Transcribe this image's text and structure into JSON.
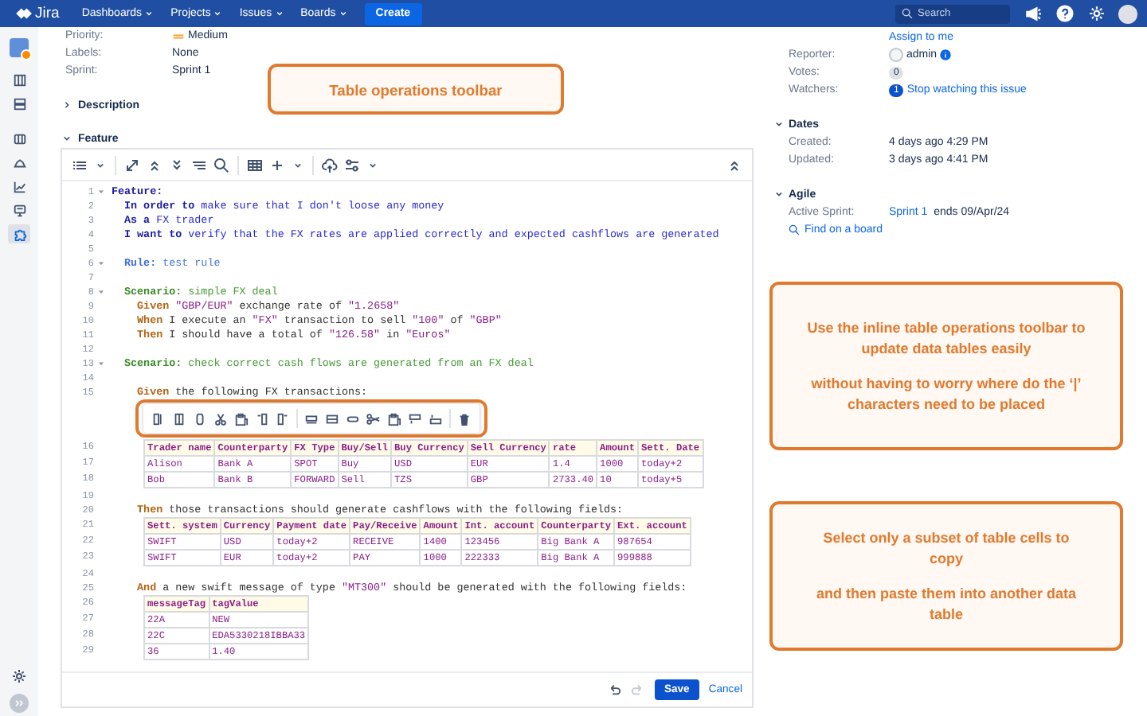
{
  "topbar": {
    "menus": [
      {
        "label": "Dashboards"
      },
      {
        "label": "Projects"
      },
      {
        "label": "Issues"
      },
      {
        "label": "Boards"
      }
    ],
    "logo": "Jira",
    "create": "Create",
    "search": {
      "placeholder": "Search"
    }
  },
  "sidebar": {
    "items": [
      {
        "selected": false
      },
      {
        "selected": false
      },
      {
        "selected": false
      },
      {
        "selected": false
      },
      {
        "selected": false
      },
      {
        "selected": false
      },
      {
        "selected": true
      }
    ]
  },
  "fields": [
    {
      "label": "Priority:",
      "value": "Medium",
      "kind": "priority"
    },
    {
      "label": "Labels:",
      "value": "None",
      "kind": "text"
    },
    {
      "label": "Sprint:",
      "value": "Sprint 1",
      "kind": "text"
    }
  ],
  "sections": [
    {
      "title": "Description",
      "expanded": false
    },
    {
      "title": "Feature",
      "expanded": true
    }
  ],
  "editor": {
    "lines": [
      {
        "kind": "feature",
        "number": "1",
        "foldable": true,
        "tokens": [
          {
            "kind": "keyword",
            "text": "Feature:"
          }
        ]
      },
      {
        "kind": "narrative",
        "number": "2",
        "foldable": false,
        "tokens": [
          {
            "kind": "keyword",
            "text": "In order to"
          },
          {
            "kind": "narrative",
            "text": " make sure that I don't loose any money"
          }
        ]
      },
      {
        "kind": "narrative",
        "number": "3",
        "foldable": false,
        "tokens": [
          {
            "kind": "keyword",
            "text": "As a"
          },
          {
            "kind": "narrative",
            "text": " FX trader"
          }
        ]
      },
      {
        "kind": "narrative",
        "number": "4",
        "foldable": false,
        "tokens": [
          {
            "kind": "keyword",
            "text": "I want to"
          },
          {
            "kind": "narrative",
            "text": " verify that the FX rates are applied correctly and expected cashflows are generated"
          }
        ]
      },
      {
        "kind": "blank",
        "number": "5",
        "foldable": false
      },
      {
        "kind": "rule",
        "number": "6",
        "foldable": true,
        "tokens": [
          {
            "kind": "rule_keyword",
            "text": "Rule:"
          },
          {
            "kind": "rule",
            "text": " test rule"
          }
        ]
      },
      {
        "kind": "blank",
        "number": "7",
        "foldable": false
      },
      {
        "kind": "scenario",
        "number": "8",
        "foldable": true,
        "tokens": [
          {
            "kind": "scenario_keyword",
            "text": "Scenario:"
          },
          {
            "kind": "scenario",
            "text": " simple FX deal"
          }
        ]
      },
      {
        "kind": "step",
        "number": "9",
        "foldable": false,
        "tokens": [
          {
            "kind": "step_keyword",
            "text": "Given"
          },
          {
            "kind": "string",
            "text": " \"GBP/EUR\""
          },
          {
            "kind": "text",
            "text": " exchange rate of "
          },
          {
            "kind": "string",
            "text": "\"1.2658\""
          }
        ]
      },
      {
        "kind": "step",
        "number": "10",
        "foldable": false,
        "tokens": [
          {
            "kind": "step_keyword",
            "text": "When"
          },
          {
            "kind": "text",
            "text": " I execute an "
          },
          {
            "kind": "string",
            "text": "\"FX\""
          },
          {
            "kind": "text",
            "text": " transaction to sell "
          },
          {
            "kind": "string",
            "text": "\"100\""
          },
          {
            "kind": "text",
            "text": " of "
          },
          {
            "kind": "string",
            "text": "\"GBP\""
          }
        ]
      },
      {
        "kind": "step",
        "number": "11",
        "foldable": false,
        "tokens": [
          {
            "kind": "step_keyword",
            "text": "Then"
          },
          {
            "kind": "text",
            "text": " I should have a total of "
          },
          {
            "kind": "string",
            "text": "\"126.58\""
          },
          {
            "kind": "text",
            "text": " in "
          },
          {
            "kind": "string",
            "text": "\"Euros\""
          }
        ]
      },
      {
        "kind": "blank",
        "number": "12",
        "foldable": false
      },
      {
        "kind": "scenario",
        "number": "13",
        "foldable": true,
        "tokens": [
          {
            "kind": "scenario_keyword",
            "text": "Scenario:"
          },
          {
            "kind": "scenario",
            "text": " check correct cash flows are generated from an FX deal"
          }
        ]
      },
      {
        "kind": "blank",
        "number": "14",
        "foldable": false
      },
      {
        "kind": "step",
        "number": "15",
        "foldable": false,
        "tokens": [
          {
            "kind": "step_keyword",
            "text": "Given"
          },
          {
            "kind": "text",
            "text": " the following FX transactions:"
          }
        ]
      },
      {
        "kind": "table",
        "toolbar": {
          "highlighted": true
        },
        "rows": [
          {
            "number": "16",
            "cells": [
              "Trader name",
              "Counterparty",
              "FX Type",
              "Buy/Sell",
              "Buy Currency",
              "Sell Currency",
              "rate",
              "Amount",
              "Sett. Date"
            ]
          },
          {
            "number": "17",
            "cells": [
              "Alison",
              "Bank A",
              "SPOT",
              "Buy",
              "USD",
              "EUR",
              "1.4",
              "1000",
              "today+2"
            ]
          },
          {
            "number": "18",
            "cells": [
              "Bob",
              "Bank B",
              "FORWARD",
              "Sell",
              "TZS",
              "GBP",
              "2733.40",
              "10",
              "today+5"
            ]
          }
        ]
      },
      {
        "kind": "blank",
        "number": "19",
        "foldable": false
      },
      {
        "kind": "step",
        "number": "20",
        "foldable": false,
        "tokens": [
          {
            "kind": "step_keyword",
            "text": "Then"
          },
          {
            "kind": "text",
            "text": " those transactions should generate cashflows with the following fields:"
          }
        ]
      },
      {
        "kind": "table",
        "rows": [
          {
            "number": "21",
            "cells": [
              "Sett. system",
              "Currency",
              "Payment date",
              "Pay/Receive",
              "Amount",
              "Int. account",
              "Counterparty",
              "Ext. account"
            ]
          },
          {
            "number": "22",
            "cells": [
              "SWIFT",
              "USD",
              "today+2",
              "RECEIVE",
              "1400",
              "123456",
              "Big Bank A",
              "987654"
            ]
          },
          {
            "number": "23",
            "cells": [
              "SWIFT",
              "EUR",
              "today+2",
              "PAY",
              "1000",
              "222333",
              "Big Bank A",
              "999888"
            ]
          }
        ]
      },
      {
        "kind": "blank",
        "number": "24",
        "foldable": false
      },
      {
        "kind": "step",
        "number": "25",
        "foldable": false,
        "tokens": [
          {
            "kind": "step_keyword",
            "text": "And"
          },
          {
            "kind": "text",
            "text": " a new swift message of type "
          },
          {
            "kind": "string",
            "text": "\"MT300\""
          },
          {
            "kind": "text",
            "text": " should be generated with the following fields:"
          }
        ]
      },
      {
        "kind": "table",
        "rows": [
          {
            "number": "26",
            "cells": [
              "messageTag",
              "tagValue"
            ]
          },
          {
            "number": "27",
            "cells": [
              "22A",
              "NEW"
            ]
          },
          {
            "number": "28",
            "cells": [
              "22C",
              "EDA5330218IBBA33"
            ]
          },
          {
            "number": "29",
            "cells": [
              "36",
              "1.40"
            ]
          }
        ]
      }
    ],
    "save": "Save",
    "cancel": "Cancel"
  },
  "people": {
    "assign_link": "Assign to me",
    "rows": [
      {
        "kind": "user",
        "label": "Reporter:",
        "value": "admin"
      },
      {
        "kind": "count",
        "label": "Votes:",
        "count": "0"
      },
      {
        "kind": "watch",
        "label": "Watchers:",
        "count": "1",
        "link": "Stop watching this issue"
      }
    ]
  },
  "dates": {
    "title": "Dates",
    "expanded": true,
    "rows": [
      {
        "label": "Created:",
        "value": "4 days ago 4:29 PM"
      },
      {
        "label": "Updated:",
        "value": "3 days ago 4:41 PM"
      }
    ]
  },
  "agile": {
    "title": "Agile",
    "expanded": true,
    "label": "Active Sprint:",
    "link": "Sprint 1",
    "value": " ends 09/Apr/24",
    "find_link": "Find on a board"
  },
  "callouts": [
    {
      "paragraphs": [
        "Table operations toolbar"
      ]
    },
    {
      "paragraphs": [
        "Use the inline table operations toolbar to update data tables easily",
        "without having to worry where do the ‘|’ characters need to be placed"
      ]
    },
    {
      "paragraphs": [
        "Select only a subset of table cells to copy",
        "and then paste them into another data table"
      ]
    }
  ]
}
